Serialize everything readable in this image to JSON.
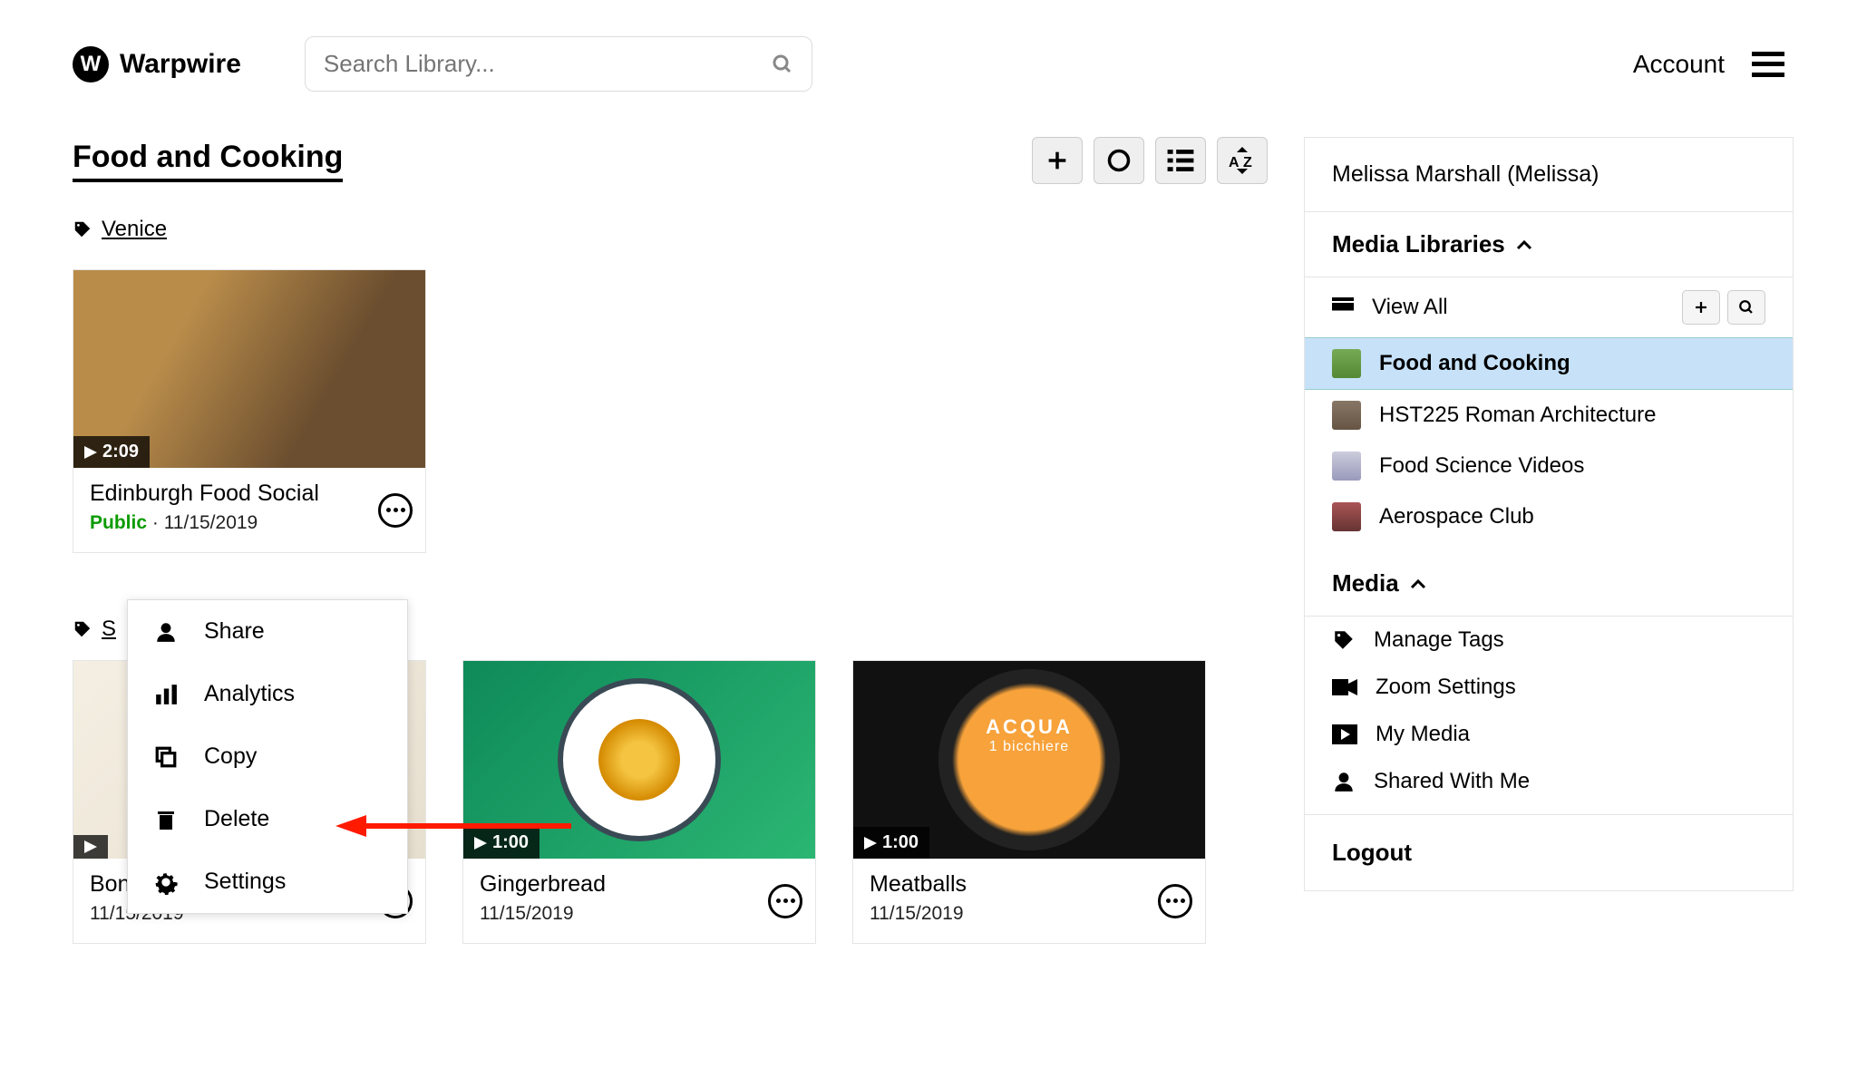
{
  "header": {
    "brand": "Warpwire",
    "search_placeholder": "Search Library...",
    "account_label": "Account"
  },
  "page": {
    "title": "Food and Cooking",
    "tag": "Venice"
  },
  "toolbar": {
    "add": "add",
    "circle": "record",
    "list": "list-view",
    "sort": "sort-az"
  },
  "cards": [
    {
      "title": "Edinburgh Food Social",
      "public": "Public",
      "date": "11/15/2019",
      "dur": "2:09"
    },
    {
      "title": "Bonne Maman Blueb…",
      "date": "11/15/2019",
      "dur": ""
    },
    {
      "title": "Gingerbread",
      "date": "11/15/2019",
      "dur": "1:00"
    },
    {
      "title": "Meatballs",
      "date": "11/15/2019",
      "dur": "1:00"
    }
  ],
  "context_menu": {
    "share": "Share",
    "analytics": "Analytics",
    "copy": "Copy",
    "delete": "Delete",
    "settings": "Settings"
  },
  "row2_tag_prefix": "S",
  "sidebar": {
    "user": "Melissa Marshall (Melissa)",
    "libraries_heading": "Media Libraries",
    "view_all": "View All",
    "libs": [
      "Food and Cooking",
      "HST225 Roman Architecture",
      "Food Science Videos",
      "Aerospace Club"
    ],
    "media_heading": "Media",
    "media_items": [
      "Manage Tags",
      "Zoom Settings",
      "My Media",
      "Shared With Me"
    ],
    "logout": "Logout"
  },
  "overlay": {
    "acqua": "ACQUA",
    "acqua_sub": "1 bicchiere"
  }
}
